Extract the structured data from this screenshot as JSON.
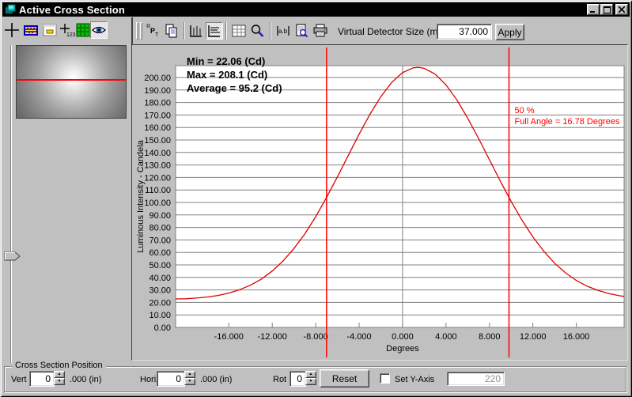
{
  "window": {
    "title": "Active Cross Section"
  },
  "titlebar": {
    "minimize_glyph": "_",
    "maximize_glyph": "▢",
    "close_glyph": "✕"
  },
  "toolbar": {
    "left_icons": [
      "crosshair-icon",
      "detector-array-icon",
      "image-window-icon",
      "coordinate-readout-icon",
      "color-grid-icon",
      "eye-icon"
    ],
    "right_icons": [
      "profile-pt-icon",
      "copy-icon",
      "vertical-profile-icon",
      "horizontal-profile-icon",
      "table-icon",
      "zoom-icon",
      "annotate-icon",
      "print-preview-icon",
      "print-icon"
    ],
    "detector_label": "Virtual Detector Size (mm)",
    "detector_value": "37.000",
    "apply_label": "Apply"
  },
  "cross_section_position": {
    "group_label": "Cross Section Position",
    "vert_label": "Vert",
    "vert_value": "0",
    "vert_unit": ".000 (in)",
    "horiz_label": "Horiz",
    "horiz_value": "0",
    "horiz_unit": ".000 (in)",
    "rot_label": "Rot",
    "rot_value": "0",
    "reset_label": "Reset",
    "set_y_axis_label": "Set Y-Axis",
    "set_y_axis_checked": false,
    "y_axis_value": "220"
  },
  "chart_data": {
    "type": "line",
    "title": "",
    "xlabel": "Degrees",
    "ylabel": "Luminous Intensity - Candela",
    "xlim": [
      -20.9,
      20.4
    ],
    "ylim": [
      0,
      209.5
    ],
    "grid": "horizontal every 10 Cd; single vertical gridline at 0 degrees",
    "x_tick_values": [
      -16,
      -12,
      -8,
      -4,
      0,
      4,
      8,
      12,
      16
    ],
    "x_tick_labels": [
      "-16.000",
      "-12.000",
      "-8.000",
      "-4.000",
      "0.000",
      "4.000",
      "8.000",
      "12.000",
      "16.000"
    ],
    "y_tick_values": [
      0,
      10,
      20,
      30,
      40,
      50,
      60,
      70,
      80,
      90,
      100,
      110,
      120,
      130,
      140,
      150,
      160,
      170,
      180,
      190,
      200
    ],
    "y_tick_labels": [
      "0.00",
      "10.00",
      "20.00",
      "30.00",
      "40.00",
      "50.00",
      "60.00",
      "70.00",
      "80.00",
      "90.00",
      "100.00",
      "110.00",
      "120.00",
      "130.00",
      "140.00",
      "150.00",
      "160.00",
      "170.00",
      "180.00",
      "190.00",
      "200.00"
    ],
    "stats": {
      "min": "Min = 22.06 (Cd)",
      "max": "Max = 208.1 (Cd)",
      "average": "Average = 95.2 (Cd)"
    },
    "marker_lines_deg": [
      -7.0,
      9.8
    ],
    "marker_label_lines": [
      "50 %",
      "Full Angle = 16.78 Degrees"
    ],
    "marker_color": "#ff0000",
    "series": [
      {
        "name": "luminous-intensity-cross-section",
        "color": "#dd0000",
        "x": [
          -20.9,
          -20,
          -19,
          -18,
          -17,
          -16,
          -15,
          -14,
          -13,
          -12,
          -11,
          -10,
          -9,
          -8,
          -7,
          -6,
          -5,
          -4,
          -3,
          -2,
          -1,
          0,
          1,
          1.5,
          2,
          3,
          4,
          5,
          6,
          7,
          8,
          9,
          10,
          11,
          12,
          13,
          14,
          15,
          16,
          17,
          18,
          19,
          20,
          20.4
        ],
        "y": [
          22.8,
          22.9,
          23.5,
          24.3,
          25.6,
          27.5,
          30.2,
          33.8,
          38.7,
          45.1,
          53.2,
          63.1,
          74.9,
          88.6,
          104.0,
          120.5,
          137.6,
          154.6,
          170.6,
          184.7,
          196.1,
          203.9,
          207.8,
          208.1,
          207.3,
          202.7,
          194.1,
          182.1,
          167.5,
          151.3,
          134.2,
          117.1,
          100.8,
          85.8,
          72.4,
          61.0,
          51.4,
          43.7,
          37.6,
          33.0,
          29.6,
          27.1,
          25.3,
          24.8
        ]
      }
    ]
  }
}
